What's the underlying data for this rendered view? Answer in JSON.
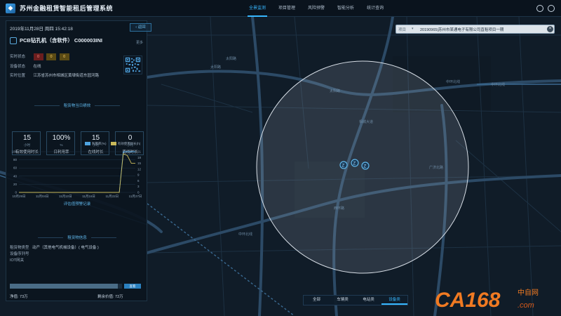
{
  "app": {
    "title": "苏州金融租赁智能租后管理系统"
  },
  "nav": {
    "items": [
      {
        "label": "全景监测"
      },
      {
        "label": "项目管理"
      },
      {
        "label": "风险预警"
      },
      {
        "label": "智能分析"
      },
      {
        "label": "统计查询"
      }
    ],
    "active_index": 0
  },
  "panel": {
    "datetime": "2019年11月28日 周四 15:42:18",
    "back_label": "返回",
    "device_name": "PCB钻孔机（含软件） C000003INI",
    "more_label": "更多",
    "realtime_status_label": "实时状态",
    "status_badges": [
      "0",
      "0",
      "0"
    ],
    "device_status_label": "设备状态",
    "device_status_value": "在线",
    "location_label": "实时位置",
    "location_value": "江苏省苏州市相城区黄埭街道东园河路",
    "daily_title": "租赁物当日绩效",
    "kpis": [
      {
        "value": "15",
        "unit": "小时",
        "label": "有效使用时长"
      },
      {
        "value": "100%",
        "unit": "%",
        "label": "日利用率"
      },
      {
        "value": "15",
        "unit": "小时",
        "label": "在线时长"
      },
      {
        "value": "0",
        "unit": "小时",
        "label": "离线时长"
      }
    ],
    "legend": [
      {
        "label": "利用率(%)",
        "color": "#4ea3e0"
      },
      {
        "label": "有效使用时长(h)",
        "color": "#c9b95a"
      }
    ],
    "alert_link": "评估值预警记录",
    "asset_info_title": "租赁物信息",
    "asset_type_label": "租赁物类型",
    "asset_type_value": "动产（其他电气机械设备）( 电气设备 )",
    "serial_label": "设备序列号",
    "serial_value": "",
    "iot_label": "IOT网关",
    "iot_value": "",
    "progress_fraction": 0.96,
    "progress_btn": "查看",
    "net_value": "净值: 73万",
    "residual_value": "剩余价值: 72万"
  },
  "chart_data": {
    "type": "line",
    "x": [
      "10月29日",
      "11月04日",
      "11月10日",
      "11月16日",
      "11月22日",
      "11月27日"
    ],
    "y_left_ticks": [
      "0",
      "20",
      "40",
      "60",
      "80",
      "100"
    ],
    "y_right_ticks": [
      "0",
      "3",
      "6",
      "9",
      "12",
      "15",
      "18",
      "21"
    ],
    "ylim_left": [
      0,
      100
    ],
    "ylim_right": [
      0,
      21
    ],
    "series": [
      {
        "name": "利用率(%)",
        "axis": "left",
        "values": [
          0,
          0,
          0,
          0,
          0,
          0,
          0,
          0,
          0,
          0,
          0,
          0,
          0,
          0,
          0,
          0,
          0,
          0,
          0,
          0,
          0,
          0,
          0,
          0,
          0,
          0,
          100,
          100,
          100,
          100
        ]
      },
      {
        "name": "有效使用时长(h)",
        "axis": "right",
        "values": [
          0,
          0,
          0,
          0,
          0,
          0,
          0,
          0,
          0,
          0,
          0,
          0,
          0,
          0,
          0,
          0,
          0,
          0,
          0,
          0,
          0,
          0,
          0,
          0,
          0,
          0,
          20,
          19,
          15,
          15
        ]
      }
    ]
  },
  "search": {
    "project_label": "项目",
    "value": "20190965|苏州市某通电子有限公司直租项目一期"
  },
  "map": {
    "road_labels": [
      "太阳路",
      "太阳路",
      "太阳路",
      "中环北线",
      "中环北线",
      "中环北线",
      "广济北路",
      "相城大道",
      "西环路"
    ]
  },
  "bottom_tabs": [
    "全部",
    "车辆类",
    "电站类",
    "设备类"
  ],
  "bottom_active": 3,
  "watermark": {
    "text": "CA168",
    "cn": "中自网",
    "domain": ".com"
  }
}
